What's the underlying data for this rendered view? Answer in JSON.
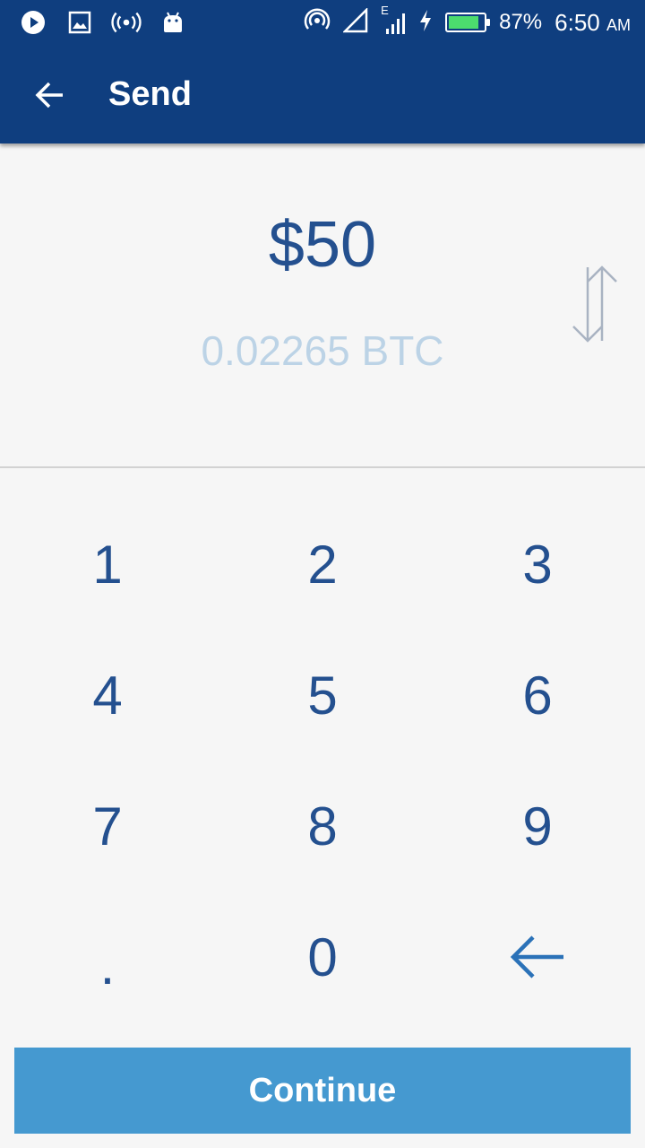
{
  "status_bar": {
    "battery_percent": "87%",
    "time": "6:50",
    "ampm": "AM",
    "network_label": "E",
    "left_icons": [
      "play-icon",
      "image-icon",
      "hotspot-icon",
      "android-icon"
    ],
    "battery_level": 0.87,
    "battery_color": "#4cdc6e"
  },
  "toolbar": {
    "title": "Send",
    "background": "#0f3e7f"
  },
  "amount": {
    "fiat": "$50",
    "crypto": "0.02265 BTC",
    "fiat_color": "#24508f",
    "crypto_color": "#bcd3e6"
  },
  "keypad": {
    "keys": [
      "1",
      "2",
      "3",
      "4",
      "5",
      "6",
      "7",
      "8",
      "9",
      ".",
      "0"
    ],
    "backspace_icon": "backspace-arrow-icon"
  },
  "continue_button": {
    "label": "Continue",
    "color": "#4599d0"
  }
}
